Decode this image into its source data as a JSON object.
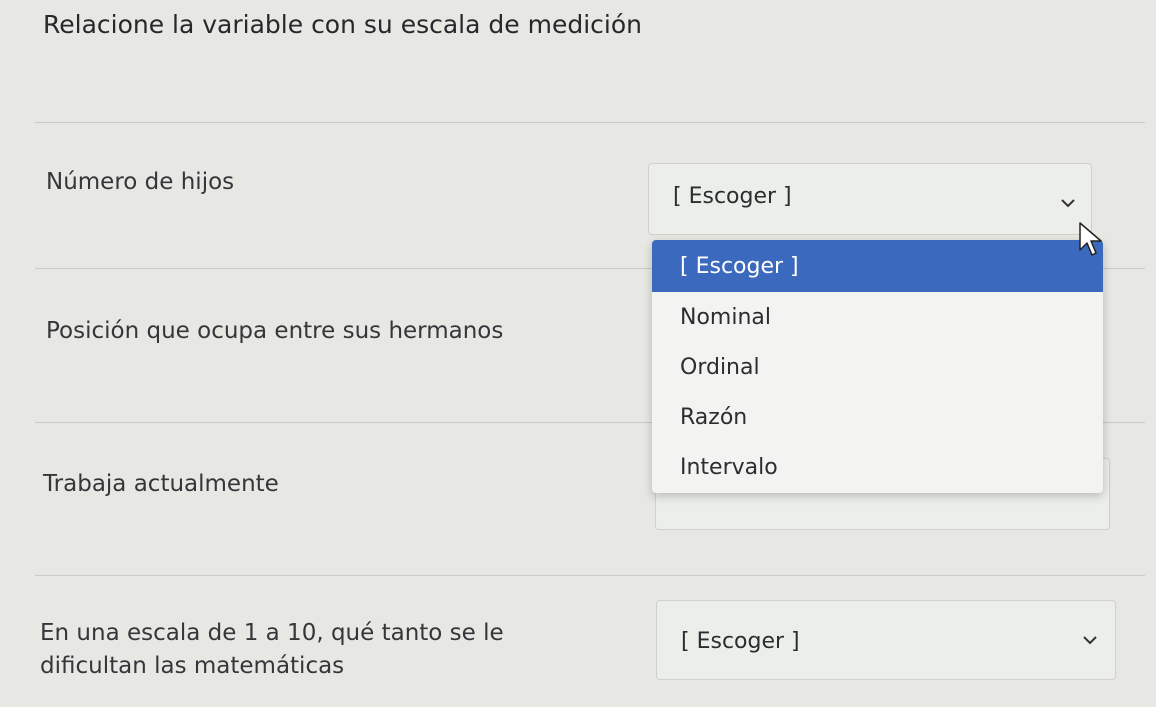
{
  "title": "Relacione la variable con su escala de medición",
  "rows": [
    {
      "label": "Número de hijos",
      "select": {
        "value": "[ Escoger ]"
      }
    },
    {
      "label": "Posición que ocupa entre sus hermanos"
    },
    {
      "label": "Trabaja actualmente"
    },
    {
      "label_line1": "En una escala de 1 a 10, qué tanto se le",
      "label_line2": "dificultan las matemáticas",
      "select": {
        "value": "[ Escoger ]"
      }
    }
  ],
  "dropdown": {
    "options": [
      "[ Escoger ]",
      "Nominal",
      "Ordinal",
      "Razón",
      "Intervalo"
    ],
    "selected_index": 0
  },
  "colors": {
    "selected_option_bg": "#3b69bd",
    "page_bg": "#e7e8e3"
  }
}
